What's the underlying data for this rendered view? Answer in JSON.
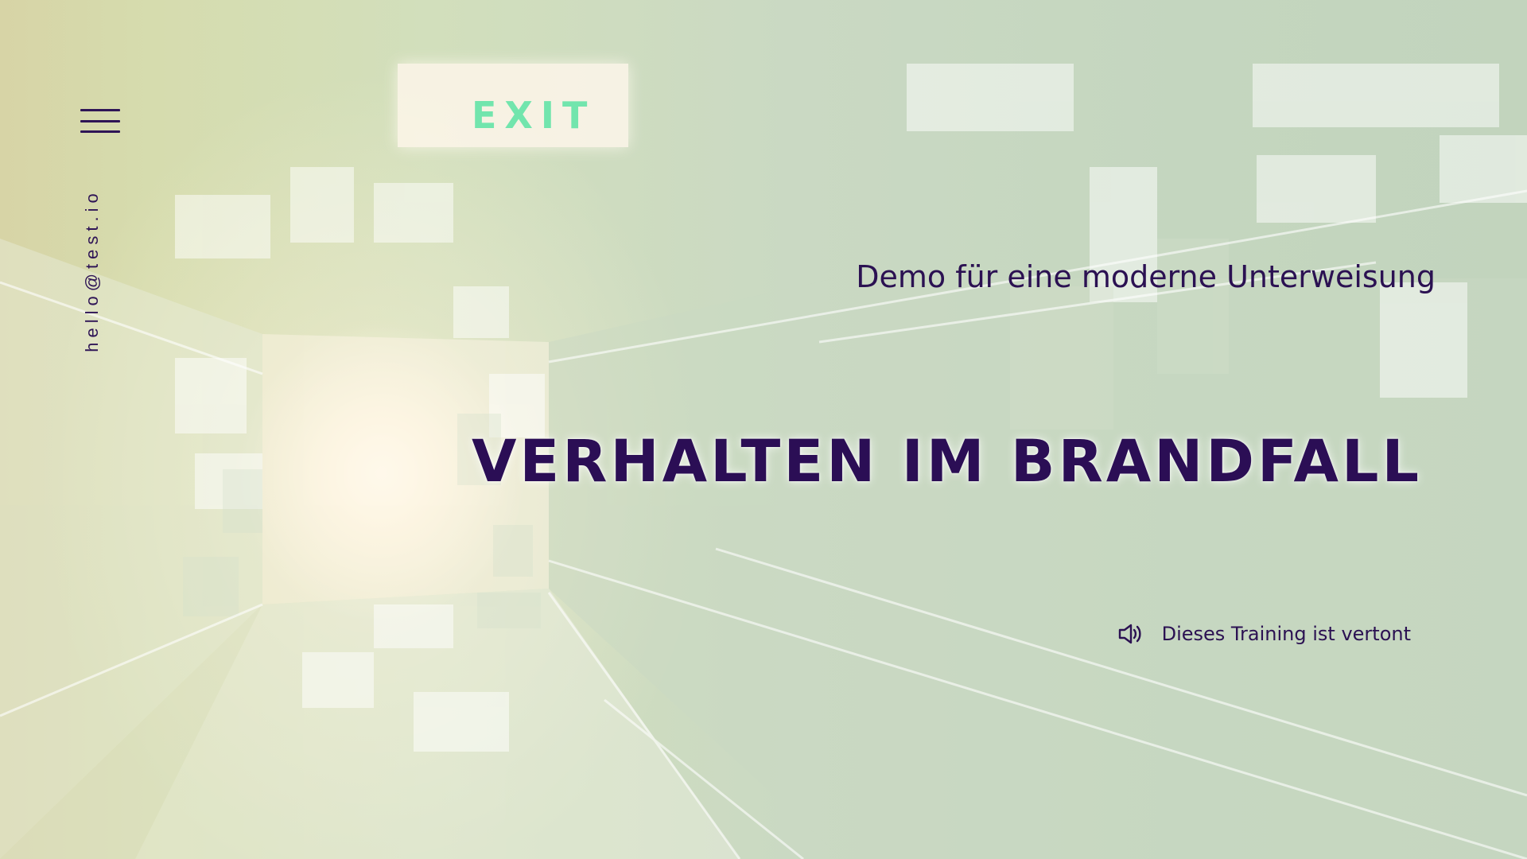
{
  "header": {
    "menu_icon": "hamburger-icon",
    "email": "hello@test.io"
  },
  "scene": {
    "exit_sign_text": "EXIT"
  },
  "hero": {
    "subtitle": "Demo für eine moderne Unterweisung",
    "title": "VERHALTEN IM BRANDFALL"
  },
  "audio_note": {
    "icon": "speaker-icon",
    "label": "Dieses Training ist vertont"
  },
  "colors": {
    "text_primary": "#2b1152",
    "exit_sign": "#72e5ad",
    "background_left": "#d7d4a6",
    "background_right": "#c2d4bd"
  }
}
